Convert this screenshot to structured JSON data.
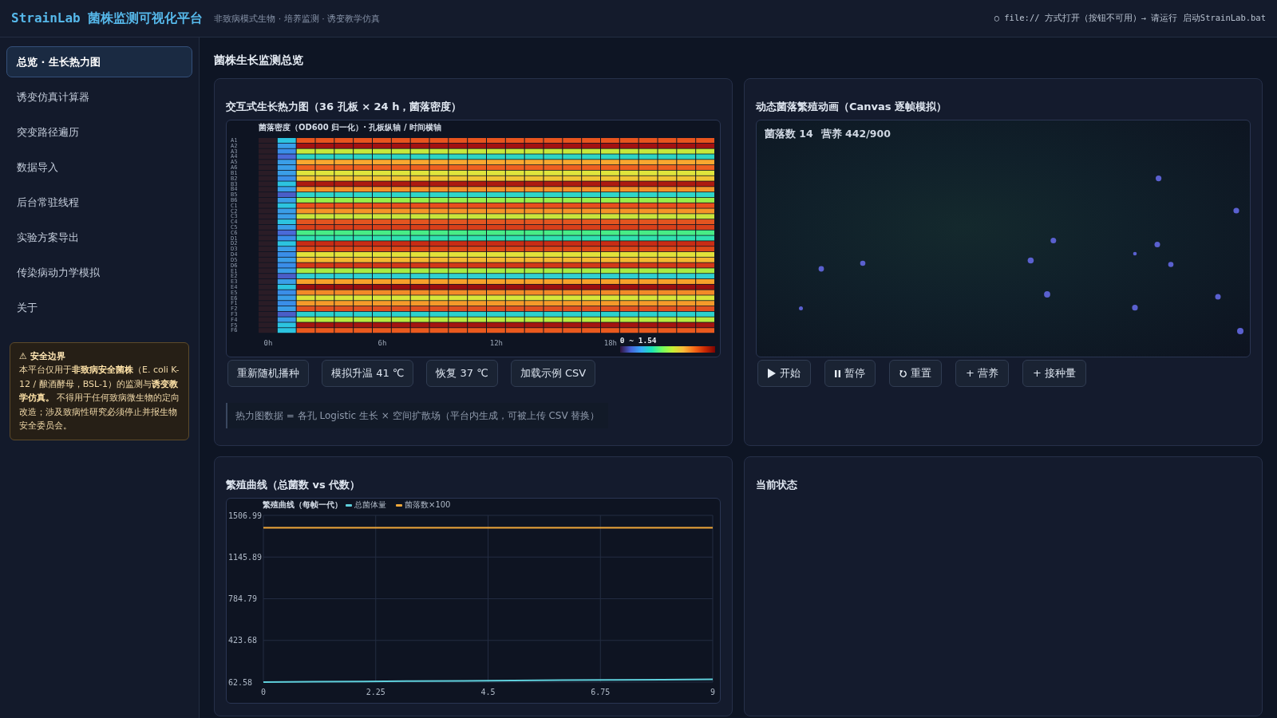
{
  "header": {
    "title": "StrainLab 菌株监测可视化平台",
    "subtitle": "非致病模式生物 · 培养监测 · 诱变教学仿真",
    "status": "○ file:// 方式打开（按钮不可用）→ 请运行 启动StrainLab.bat"
  },
  "sidebar": {
    "items": [
      {
        "label": "总览 · 生长热力图",
        "selected": true
      },
      {
        "label": "诱变仿真计算器",
        "selected": false
      },
      {
        "label": "突变路径遍历",
        "selected": false
      },
      {
        "label": "数据导入",
        "selected": false
      },
      {
        "label": "后台常驻线程",
        "selected": false
      },
      {
        "label": "实验方案导出",
        "selected": false
      },
      {
        "label": "传染病动力学模拟",
        "selected": false
      },
      {
        "label": "关于",
        "selected": false
      }
    ],
    "notice": {
      "title": "⚠ 安全边界",
      "text": "本平台仅用于**非致病安全菌株**（E. coli K-12 / 酿酒酵母，BSL-1）的监测与**诱变教学仿真。** 不得用于任何致病微生物的定向改造；涉及致病性研究必须停止并报生物安全委员会。"
    }
  },
  "page_title": "菌株生长监测总览",
  "heatmap_panel": {
    "title": "交互式生长热力图（36 孔板 × 24 h，菌落密度）",
    "heatmap": {
      "title": "菌落密度（OD600 归一化）· 孔板纵轴 / 时间横轴",
      "row_labels": [
        "A1",
        "A2",
        "A3",
        "A4",
        "A5",
        "A6",
        "B1",
        "B2",
        "B3",
        "B4",
        "B5",
        "B6",
        "C1",
        "C2",
        "C3",
        "C4",
        "C5",
        "C6",
        "D1",
        "D2",
        "D3",
        "D4",
        "D5",
        "D6",
        "E1",
        "E2",
        "E3",
        "E4",
        "E5",
        "E6",
        "F1",
        "F2",
        "F3",
        "F4",
        "F5",
        "F6"
      ],
      "x_labels": [
        "0h",
        "6h",
        "12h",
        "18h"
      ],
      "legend": "0 ~ 1.54"
    },
    "buttons": [
      {
        "label": "重新随机播种"
      },
      {
        "label": "模拟升温 41 ℃"
      },
      {
        "label": "恢复 37 ℃"
      },
      {
        "label": "加载示例 CSV"
      }
    ],
    "note": "热力图数据 = 各孔 Logistic 生长 × 空间扩散场（平台内生成，可被上传 CSV 替换）"
  },
  "animation_panel": {
    "title": "动态菌落繁殖动画（Canvas 逐帧模拟）",
    "colony_count": "菌落数 14",
    "nutrient": "营养 442/900",
    "buttons": [
      {
        "kind": "start",
        "label": "开始"
      },
      {
        "kind": "pause",
        "label": "暂停"
      },
      {
        "kind": "reset",
        "label": "重置"
      },
      {
        "kind": "add",
        "label": "+ 营养"
      },
      {
        "kind": "add",
        "label": "+ 接种量"
      }
    ]
  },
  "curve_panel": {
    "title": "繁殖曲线（总菌数 vs 代数）",
    "chart_data": {
      "type": "line",
      "title": "繁殖曲线（每帧一代）",
      "x": [
        0,
        1,
        2,
        3,
        4,
        5,
        6,
        7,
        8,
        9
      ],
      "series": [
        {
          "name": "总菌体量",
          "color": "#5fd0dc",
          "values": [
            63,
            66,
            68,
            71,
            73,
            76,
            79,
            82,
            84,
            87
          ]
        },
        {
          "name": "菌落数×100",
          "color": "#f0a83a",
          "values": [
            1400,
            1400,
            1400,
            1400,
            1400,
            1400,
            1400,
            1400,
            1400,
            1400
          ]
        }
      ],
      "xlim": [
        0,
        9
      ],
      "ylim": [
        62.58,
        1506.99
      ],
      "xticks": [
        0,
        2.25,
        4.5,
        6.75,
        9
      ],
      "yticks": [
        62.58,
        423.68,
        784.79,
        1145.89,
        1506.99
      ],
      "grid": true,
      "legend": "top"
    }
  },
  "status_panel": {
    "title": "当前状态"
  }
}
